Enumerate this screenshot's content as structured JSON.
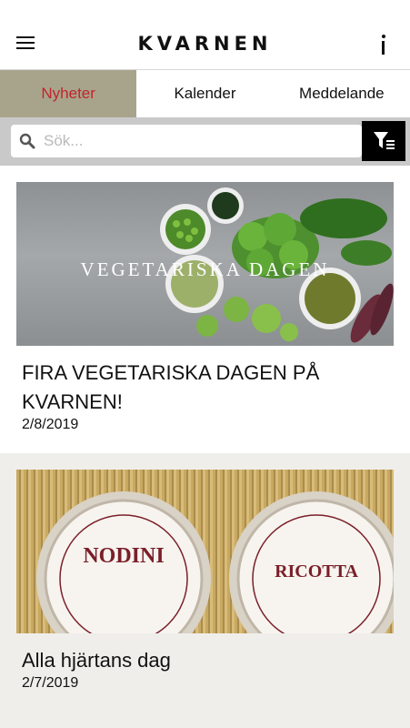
{
  "header": {
    "logo": "KVARNEN"
  },
  "tabs": [
    {
      "label": "Nyheter",
      "active": true
    },
    {
      "label": "Kalender",
      "active": false
    },
    {
      "label": "Meddelande",
      "active": false
    }
  ],
  "search": {
    "placeholder": "Sök...",
    "value": ""
  },
  "feed": [
    {
      "image_text": "VEGETARISKA DAGEN",
      "title": "FIRA VEGETARISKA DAGEN PÅ KVARNEN!",
      "date": "2/8/2019"
    },
    {
      "image_text_left": "NODINI",
      "image_text_right": "RICOTTA",
      "title": "Alla hjärtans dag",
      "date": "2/7/2019"
    }
  ],
  "colors": {
    "active_tab_bg": "#a8a48b",
    "active_tab_text": "#c0252e",
    "search_bar_bg": "#c9c9c9",
    "card_alt_bg": "#efeeea"
  },
  "icons": [
    "menu-icon",
    "info-icon",
    "search-icon",
    "filter-icon"
  ]
}
